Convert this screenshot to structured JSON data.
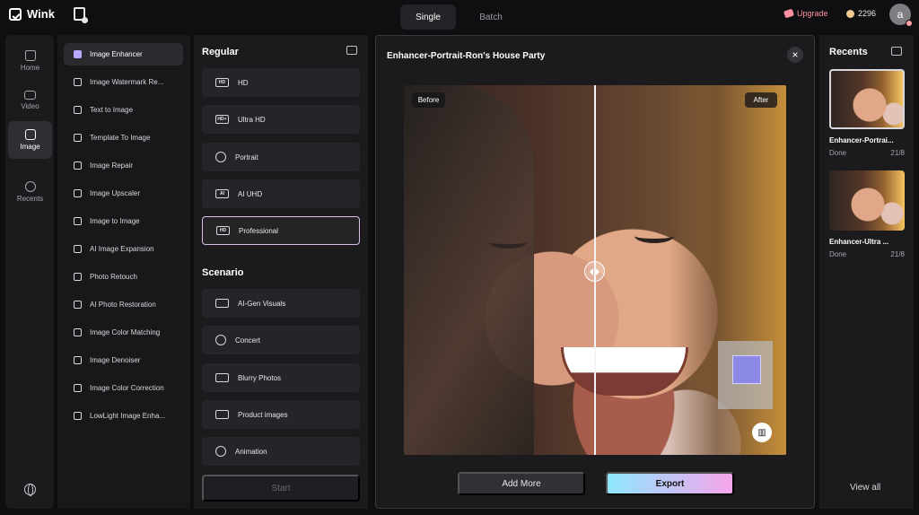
{
  "app": {
    "name": "Wink",
    "upgrade": "Upgrade",
    "credits": "2296",
    "avatar": "a"
  },
  "mode_tabs": [
    {
      "label": "Single"
    },
    {
      "label": "Batch"
    }
  ],
  "left_nav": [
    {
      "label": "Home"
    },
    {
      "label": "Video"
    },
    {
      "label": "Image"
    },
    {
      "label": "Recents"
    }
  ],
  "tools": [
    {
      "label": "Image Enhancer"
    },
    {
      "label": "Image Watermark Re..."
    },
    {
      "label": "Text to Image"
    },
    {
      "label": "Template To Image"
    },
    {
      "label": "Image Repair"
    },
    {
      "label": "Image Upscaler"
    },
    {
      "label": "Image to Image"
    },
    {
      "label": "AI Image Expansion"
    },
    {
      "label": "Photo Retouch"
    },
    {
      "label": "AI Photo Restoration"
    },
    {
      "label": "Image Color Matching"
    },
    {
      "label": "Image Denoiser"
    },
    {
      "label": "Image Color Correction"
    },
    {
      "label": "LowLight Image Enha..."
    }
  ],
  "regular": {
    "title": "Regular",
    "options": [
      {
        "label": "HD",
        "icon": "HD"
      },
      {
        "label": "Ultra HD",
        "icon": "HD+"
      },
      {
        "label": "Portrait",
        "icon": ""
      },
      {
        "label": "AI UHD",
        "icon": "AI"
      },
      {
        "label": "Professional",
        "icon": "HD"
      }
    ]
  },
  "scenario": {
    "title": "Scenario",
    "options": [
      {
        "label": "AI-Gen Visuals"
      },
      {
        "label": "Concert"
      },
      {
        "label": "Blurry Photos"
      },
      {
        "label": "Product images"
      },
      {
        "label": "Animation"
      }
    ],
    "start": "Start"
  },
  "preview": {
    "title": "Enhancer-Portrait-Ron's House Party",
    "before": "Before",
    "after": "After",
    "add_more": "Add More",
    "export": "Export"
  },
  "recents": {
    "title": "Recents",
    "items": [
      {
        "name": "Enhancer-Portrai...",
        "status": "Done",
        "date": "21/8"
      },
      {
        "name": "Enhancer-Ultra ...",
        "status": "Done",
        "date": "21/8"
      }
    ],
    "view_all": "View all"
  },
  "colors": {
    "background": "#0f0f11",
    "panel": "#1b1b1e",
    "accent_pink": "#ff8fa0",
    "export_gradient_start": "#8fe7ff",
    "export_gradient_end": "#f5a5ea"
  }
}
